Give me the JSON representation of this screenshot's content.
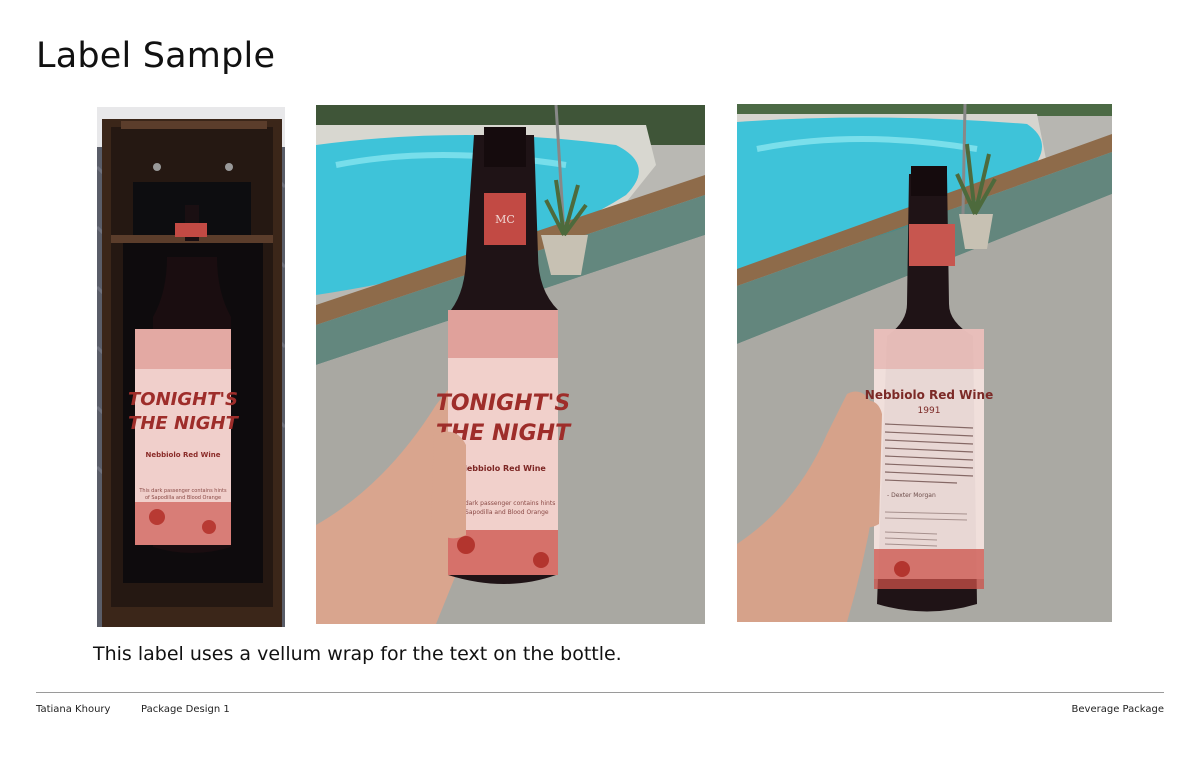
{
  "page": {
    "title": "Label Sample",
    "caption": "This label uses a vellum wrap for the text on the bottle."
  },
  "footer": {
    "author": "Tatiana Khoury",
    "course": "Package Design 1",
    "project": "Beverage Package"
  },
  "label": {
    "front_line1": "TONIGHT'S",
    "front_line2": "THE NIGHT",
    "front_wine": "Nebbiolo Red Wine",
    "front_blurb_1": "This dark passenger contains hints",
    "front_blurb_2": "of Sapodilla and Blood Orange",
    "back_wine": "Nebbiolo Red Wine",
    "back_year": "1991",
    "back_signature": "- Dexter Morgan",
    "monogram": "MC"
  },
  "colors": {
    "label_red": "#c8453d",
    "label_pink": "#f2d4d0",
    "pool_blue": "#3ec3d9",
    "bottle_dark": "#1c1214",
    "crate_wood": "#4a3224"
  }
}
